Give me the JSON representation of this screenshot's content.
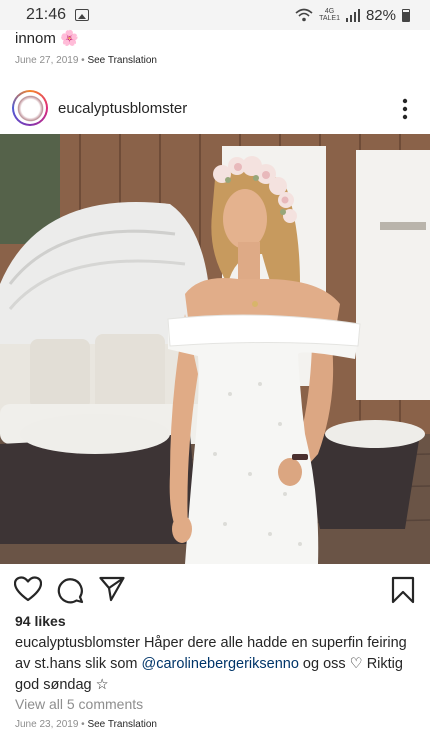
{
  "status_bar": {
    "time": "21:46",
    "network_top": "4G",
    "network_bottom": "TALE1",
    "battery": "82%"
  },
  "previous_post": {
    "caption_end": "innom 🌸",
    "date": "June 27, 2019",
    "see_translation": "See Translation"
  },
  "post": {
    "username": "eucalyptusblomster",
    "likes": "94 likes",
    "caption": {
      "username": "eucalyptusblomster",
      "text_before_mention": " Håper dere alle hadde en superfin feiring av st.hans slik som ",
      "mention": "@carolinebergeriksenno",
      "text_after_mention": " og oss ♡ Riktig god søndag ☆"
    },
    "view_comments": "View all 5 comments",
    "date": "June 23, 2019",
    "see_translation": "See Translation",
    "icons": {
      "like": "heart-icon",
      "comment": "comment-icon",
      "share": "share-icon",
      "save": "bookmark-icon",
      "more": "more-vertical-icon"
    }
  }
}
